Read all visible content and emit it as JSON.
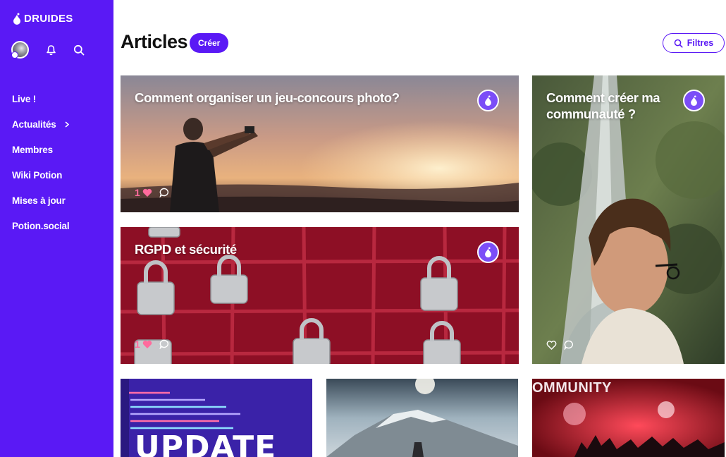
{
  "brand": {
    "name": "DRUIDES"
  },
  "sidebar": {
    "items": [
      {
        "label": "Live !"
      },
      {
        "label": "Actualités",
        "has_submenu": true
      },
      {
        "label": "Membres"
      },
      {
        "label": "Wiki Potion"
      },
      {
        "label": "Mises à jour"
      },
      {
        "label": "Potion.social"
      }
    ]
  },
  "header": {
    "title": "Articles",
    "create_label": "Créer",
    "filter_label": "Filtres"
  },
  "articles": [
    {
      "title": "Comment organiser un jeu-concours photo?",
      "likes": "1",
      "liked": true
    },
    {
      "title": "RGPD et sécurité",
      "likes": "1",
      "liked": true
    },
    {
      "title": "Comment créer ma communauté ?",
      "likes": "",
      "liked": false
    },
    {
      "title": "",
      "image_text": "UPDATE"
    },
    {
      "title": ""
    },
    {
      "title": "",
      "image_text": "OMMUNITY"
    }
  ],
  "colors": {
    "brand_purple": "#5a19f5",
    "like_pink": "#ff6b9d"
  }
}
